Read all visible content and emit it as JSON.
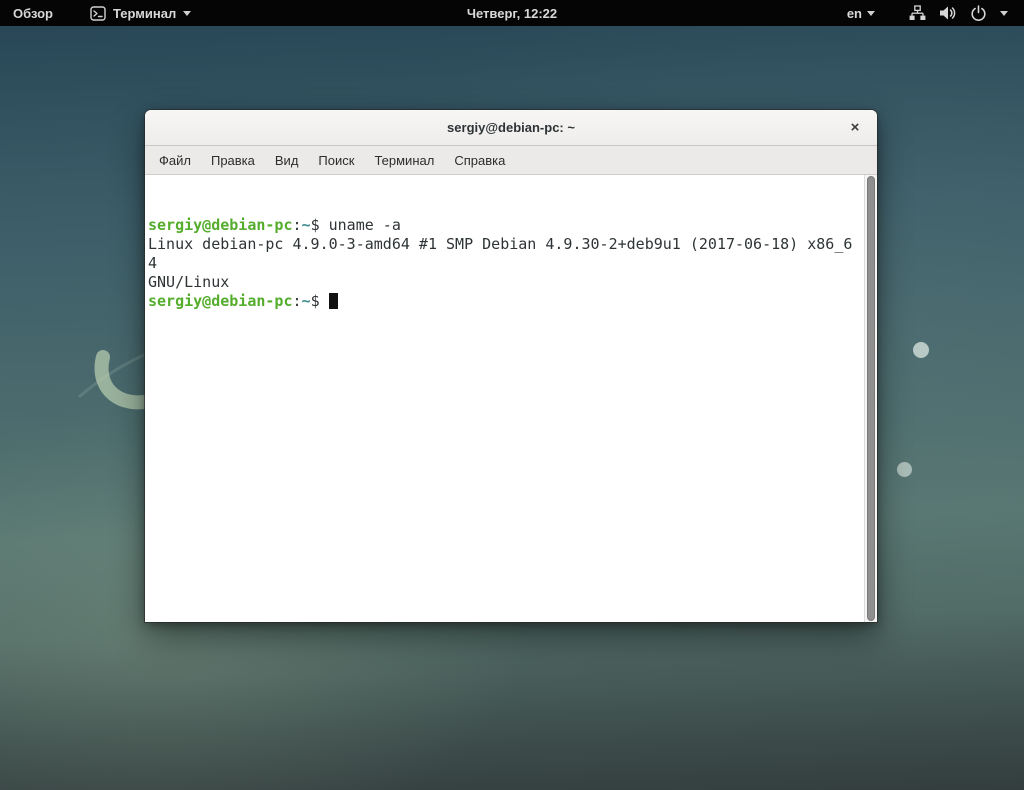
{
  "top_bar": {
    "activities_label": "Обзор",
    "app_menu_label": "Терминал",
    "clock": "Четверг, 12:22",
    "keyboard_layout": "en"
  },
  "window": {
    "title": "sergiy@debian-pc: ~",
    "close_label": "×",
    "menu_items": [
      {
        "id": "file",
        "label": "Файл"
      },
      {
        "id": "edit",
        "label": "Правка"
      },
      {
        "id": "view",
        "label": "Вид"
      },
      {
        "id": "search",
        "label": "Поиск"
      },
      {
        "id": "terminal",
        "label": "Терминал"
      },
      {
        "id": "help",
        "label": "Справка"
      }
    ]
  },
  "terminal": {
    "colors": {
      "prompt_green": "#54ad2c",
      "path_teal": "#3e8a8c",
      "foreground": "#2e3436",
      "background": "#ffffff"
    },
    "lines": [
      {
        "segments": [
          {
            "style": "green",
            "text": "sergiy@debian-pc"
          },
          {
            "style": "fg",
            "text": ":"
          },
          {
            "style": "path",
            "text": "~"
          },
          {
            "style": "fg",
            "text": "$ uname -a"
          }
        ]
      },
      {
        "segments": [
          {
            "style": "fg",
            "text": "Linux debian-pc 4.9.0-3-amd64 #1 SMP Debian 4.9.30-2+deb9u1 (2017-06-18) x86_64"
          }
        ]
      },
      {
        "segments": [
          {
            "style": "fg",
            "text": "GNU/Linux"
          }
        ]
      },
      {
        "segments": [
          {
            "style": "green",
            "text": "sergiy@debian-pc"
          },
          {
            "style": "fg",
            "text": ":"
          },
          {
            "style": "path",
            "text": "~"
          },
          {
            "style": "fg",
            "text": "$ "
          }
        ],
        "cursor": true
      }
    ]
  }
}
